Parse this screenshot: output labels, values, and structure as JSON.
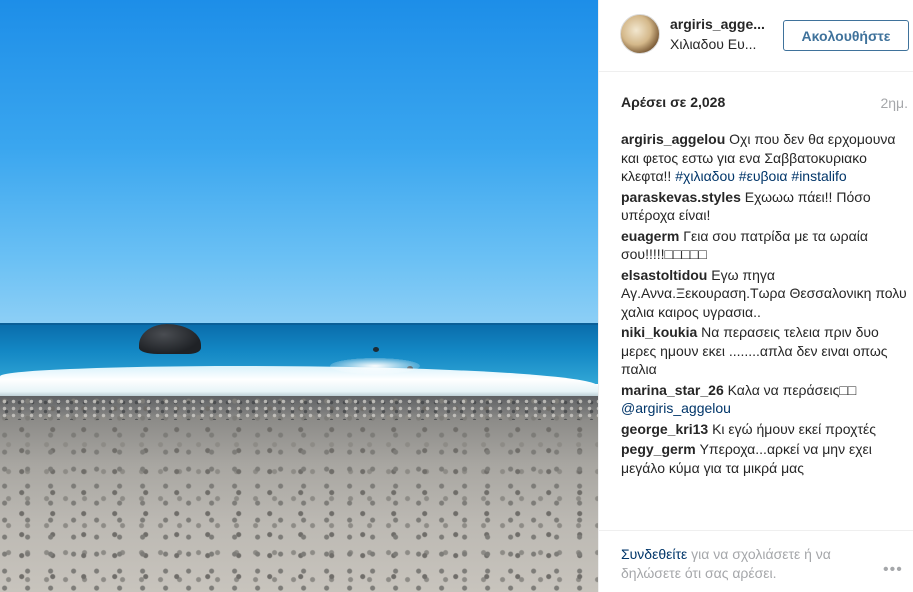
{
  "post": {
    "username": "argiris_agge...",
    "location": "Χιλιαδου Ευ...",
    "follow_label": "Ακολουθήστε",
    "likes": "Αρέσει σε 2,028",
    "time": "2ημ."
  },
  "comments": [
    {
      "user": "argiris_aggelou",
      "text": "Οχι που δεν θα ερχομουνα και φετος εστω για ενα Σαββατοκυριακο κλεφτα!!",
      "tags": "#χιλιαδου #ευβοια #instalifo"
    },
    {
      "user": "paraskevas.styles",
      "text": "Εχωωω πάει!! Πόσο υπέροχα είναι!"
    },
    {
      "user": "euagerm",
      "text": "Γεια σου πατρίδα με τα ωραία σου!!!!!□□□□□"
    },
    {
      "user": "elsastoltidou",
      "text": "Εγω πηγα Αγ.Αννα.Ξεκουραση.Τωρα Θεσσαλονικη πολυ χαλια καιρος υγρασια.."
    },
    {
      "user": "niki_koukia",
      "text": "Να περασεις τελεια πριν δυο μερες ημουν εκει ........απλα δεν ειναι οπως παλια"
    },
    {
      "user": "marina_star_26",
      "text": "Καλα να περάσεις□□",
      "tags": "@argiris_aggelou"
    },
    {
      "user": "george_kri13",
      "text": "Κι εγώ ήμουν εκεί προχτές"
    },
    {
      "user": "pegy_germ",
      "text": "Υπεροχα...αρκεί να μην εχει μεγάλο κύμα για τα μικρά μας"
    }
  ],
  "footer": {
    "login_link": "Συνδεθείτε",
    "prompt": " για να σχολιάσετε ή να δηλώσετε ότι σας αρέσει.",
    "more_label": "•••"
  },
  "icons": {
    "more": "more-options-icon"
  }
}
